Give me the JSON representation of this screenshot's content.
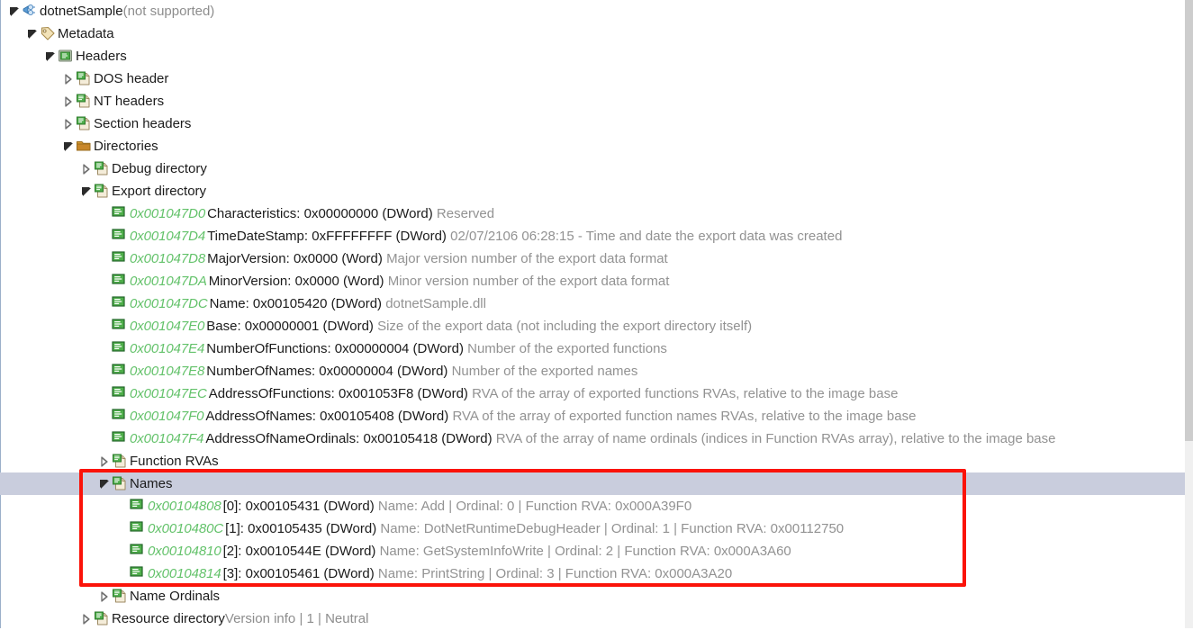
{
  "window": {
    "scrollbar": {
      "present": true
    }
  },
  "colors": {
    "address_green": "#63c26a",
    "description_gray": "#929292",
    "selection": "#c9cddd",
    "annotation_red": "#fb1309",
    "text": "#1b1b1b"
  },
  "annotation": {
    "type": "rectangle-highlight",
    "color": "#fb1309",
    "targets": "Names node and its four exported name entries"
  },
  "tree": {
    "rows": [
      {
        "indent": 0,
        "expander": "expanded",
        "icon": "plug-icon",
        "label": "dotnetSample",
        "suffix": " (not supported)",
        "selected": false,
        "kind": "node"
      },
      {
        "indent": 1,
        "expander": "expanded",
        "icon": "tag-icon",
        "label": "Metadata",
        "suffix": "",
        "selected": false,
        "kind": "node"
      },
      {
        "indent": 2,
        "expander": "expanded",
        "icon": "headers-icon",
        "label": "Headers",
        "suffix": "",
        "selected": false,
        "kind": "node"
      },
      {
        "indent": 3,
        "expander": "collapsed",
        "icon": "page-icon",
        "label": "DOS header",
        "suffix": "",
        "selected": false,
        "kind": "node"
      },
      {
        "indent": 3,
        "expander": "collapsed",
        "icon": "page-icon",
        "label": "NT headers",
        "suffix": "",
        "selected": false,
        "kind": "node"
      },
      {
        "indent": 3,
        "expander": "collapsed",
        "icon": "page-icon",
        "label": "Section headers",
        "suffix": "",
        "selected": false,
        "kind": "node"
      },
      {
        "indent": 3,
        "expander": "expanded",
        "icon": "folder-icon",
        "label": "Directories",
        "suffix": "",
        "selected": false,
        "kind": "node"
      },
      {
        "indent": 4,
        "expander": "collapsed",
        "icon": "page-icon",
        "label": "Debug directory",
        "suffix": "",
        "selected": false,
        "kind": "node"
      },
      {
        "indent": 4,
        "expander": "expanded",
        "icon": "page-icon",
        "label": "Export directory",
        "suffix": "",
        "selected": false,
        "kind": "node"
      },
      {
        "indent": 5,
        "expander": "none",
        "icon": "field-icon",
        "address": "0x001047D0",
        "field": "Characteristics: 0x00000000 (DWord)",
        "description": "Reserved",
        "selected": false,
        "kind": "field"
      },
      {
        "indent": 5,
        "expander": "none",
        "icon": "field-icon",
        "address": "0x001047D4",
        "field": "TimeDateStamp: 0xFFFFFFFF (DWord)",
        "description": "02/07/2106 06:28:15 - Time and date the export data was created",
        "selected": false,
        "kind": "field"
      },
      {
        "indent": 5,
        "expander": "none",
        "icon": "field-icon",
        "address": "0x001047D8",
        "field": "MajorVersion: 0x0000 (Word)",
        "description": "Major version number of the export data format",
        "selected": false,
        "kind": "field"
      },
      {
        "indent": 5,
        "expander": "none",
        "icon": "field-icon",
        "address": "0x001047DA",
        "field": "MinorVersion: 0x0000 (Word)",
        "description": "Minor version number of the export data format",
        "selected": false,
        "kind": "field"
      },
      {
        "indent": 5,
        "expander": "none",
        "icon": "field-icon",
        "address": "0x001047DC",
        "field": "Name: 0x00105420 (DWord)",
        "description": "dotnetSample.dll",
        "selected": false,
        "kind": "field"
      },
      {
        "indent": 5,
        "expander": "none",
        "icon": "field-icon",
        "address": "0x001047E0",
        "field": "Base: 0x00000001 (DWord)",
        "description": "Size of the export data (not including the export directory itself)",
        "selected": false,
        "kind": "field"
      },
      {
        "indent": 5,
        "expander": "none",
        "icon": "field-icon",
        "address": "0x001047E4",
        "field": "NumberOfFunctions: 0x00000004 (DWord)",
        "description": "Number of the exported functions",
        "selected": false,
        "kind": "field"
      },
      {
        "indent": 5,
        "expander": "none",
        "icon": "field-icon",
        "address": "0x001047E8",
        "field": "NumberOfNames: 0x00000004 (DWord)",
        "description": "Number of the exported names",
        "selected": false,
        "kind": "field"
      },
      {
        "indent": 5,
        "expander": "none",
        "icon": "field-icon",
        "address": "0x001047EC",
        "field": "AddressOfFunctions: 0x001053F8 (DWord)",
        "description": "RVA of the array of exported functions RVAs, relative to the image base",
        "selected": false,
        "kind": "field"
      },
      {
        "indent": 5,
        "expander": "none",
        "icon": "field-icon",
        "address": "0x001047F0",
        "field": "AddressOfNames: 0x00105408 (DWord)",
        "description": "RVA of the array of exported function names RVAs, relative to the image base",
        "selected": false,
        "kind": "field"
      },
      {
        "indent": 5,
        "expander": "none",
        "icon": "field-icon",
        "address": "0x001047F4",
        "field": "AddressOfNameOrdinals: 0x00105418 (DWord)",
        "description": "RVA of the array of name ordinals (indices in Function RVAs array), relative to the image base",
        "selected": false,
        "kind": "field"
      },
      {
        "indent": 5,
        "expander": "collapsed",
        "icon": "page-icon",
        "label": "Function RVAs",
        "suffix": "",
        "selected": false,
        "kind": "node"
      },
      {
        "indent": 5,
        "expander": "expanded",
        "icon": "page-icon",
        "label": "Names",
        "suffix": "",
        "selected": true,
        "kind": "node"
      },
      {
        "indent": 6,
        "expander": "none",
        "icon": "field-icon",
        "address": "0x00104808",
        "field": "[0]: 0x00105431 (DWord)",
        "description": "Name: Add | Ordinal: 0 | Function RVA: 0x000A39F0",
        "selected": false,
        "kind": "field"
      },
      {
        "indent": 6,
        "expander": "none",
        "icon": "field-icon",
        "address": "0x0010480C",
        "field": "[1]: 0x00105435 (DWord)",
        "description": "Name: DotNetRuntimeDebugHeader | Ordinal: 1 | Function RVA: 0x00112750",
        "selected": false,
        "kind": "field"
      },
      {
        "indent": 6,
        "expander": "none",
        "icon": "field-icon",
        "address": "0x00104810",
        "field": "[2]: 0x0010544E (DWord)",
        "description": "Name: GetSystemInfoWrite | Ordinal: 2 | Function RVA: 0x000A3A60",
        "selected": false,
        "kind": "field"
      },
      {
        "indent": 6,
        "expander": "none",
        "icon": "field-icon",
        "address": "0x00104814",
        "field": "[3]: 0x00105461 (DWord)",
        "description": "Name: PrintString | Ordinal: 3 | Function RVA: 0x000A3A20",
        "selected": false,
        "kind": "field"
      },
      {
        "indent": 5,
        "expander": "collapsed",
        "icon": "page-icon",
        "label": "Name Ordinals",
        "suffix": "",
        "selected": false,
        "kind": "node"
      },
      {
        "indent": 4,
        "expander": "collapsed",
        "icon": "page-icon",
        "label": "Resource directory",
        "suffix": " Version info | 1 | Neutral",
        "selected": false,
        "kind": "node"
      }
    ]
  }
}
